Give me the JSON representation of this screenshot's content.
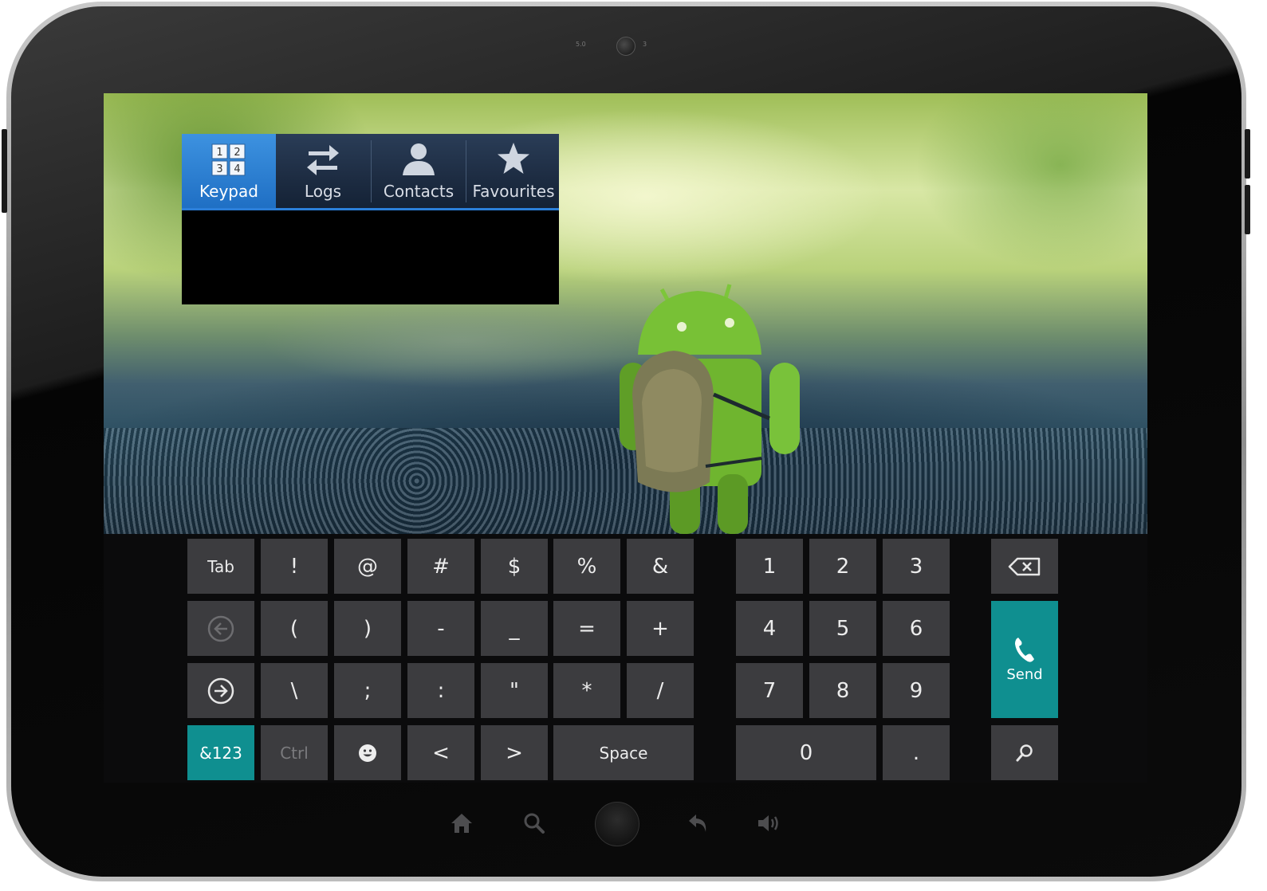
{
  "device": {
    "camera_label_left": "5.0",
    "camera_label_right": "3"
  },
  "tabs": [
    {
      "label": "Keypad",
      "icon": "keypad-icon",
      "active": true
    },
    {
      "label": "Logs",
      "icon": "swap-arrows-icon",
      "active": false
    },
    {
      "label": "Contacts",
      "icon": "person-icon",
      "active": false
    },
    {
      "label": "Favourites",
      "icon": "star-icon",
      "active": false
    }
  ],
  "keypad_icon_digits": [
    "1",
    "2",
    "3",
    "4"
  ],
  "keyboard": {
    "row1": [
      "Tab",
      "!",
      "@",
      "#",
      "$",
      "%",
      "&"
    ],
    "row2": [
      "(",
      ")",
      "-",
      "_",
      "=",
      "+"
    ],
    "row3": [
      "\\",
      ";",
      ":",
      "\"",
      "*",
      "/"
    ],
    "row4": [
      "&123",
      "Ctrl",
      "<",
      ">",
      "Space"
    ],
    "numpad": [
      "1",
      "2",
      "3",
      "4",
      "5",
      "6",
      "7",
      "8",
      "9",
      "0",
      "."
    ],
    "send_label": "Send"
  },
  "colors": {
    "accent_teal": "#0f8f90",
    "tab_active": "#2f83d6",
    "key_bg": "#3c3c3f"
  }
}
